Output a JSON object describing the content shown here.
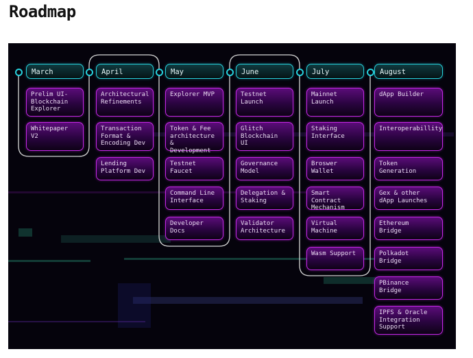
{
  "title": "Roadmap",
  "colors": {
    "month_border": "#27d3de",
    "item_border": "#c627e8",
    "background": "#05030c",
    "timeline": "#d8d8d8"
  },
  "months": [
    {
      "label": "March",
      "items": [
        "Prelim UI-\nBlockchain\nExplorer",
        "Whitepaper V2"
      ]
    },
    {
      "label": "April",
      "items": [
        "Architectural\nRefinements",
        "Transaction\nFormat &\nEncoding Dev",
        "Lending\nPlatform Dev"
      ]
    },
    {
      "label": "May",
      "items": [
        "Explorer MVP",
        "Token & Fee\narchitecture &\nDevelopment",
        "Testnet Faucet",
        "Command Line\nInterface",
        "Developer\nDocs"
      ]
    },
    {
      "label": "June",
      "items": [
        "Testnet Launch",
        "Glitch\nBlockchain UI",
        "Governance\nModel",
        "Delegation &\nStaking",
        "Validator\nArchitecture"
      ]
    },
    {
      "label": "July",
      "items": [
        "Mainnet Launch",
        "Staking\nInterface",
        "Broswer\nWallet",
        "Smart Contract\nMechanism",
        "Virtual\nMachine",
        "Wasm Support"
      ]
    },
    {
      "label": "August",
      "items": [
        "dApp Builder",
        "Interoperabillity",
        "Token\nGeneration",
        "Gex & other\ndApp Launches",
        "Ethereum\nBridge",
        "Polkadot\nBridge",
        "PBinance\nBridge",
        "IPFS & Oracle\nIntegration\nSupport"
      ]
    }
  ]
}
